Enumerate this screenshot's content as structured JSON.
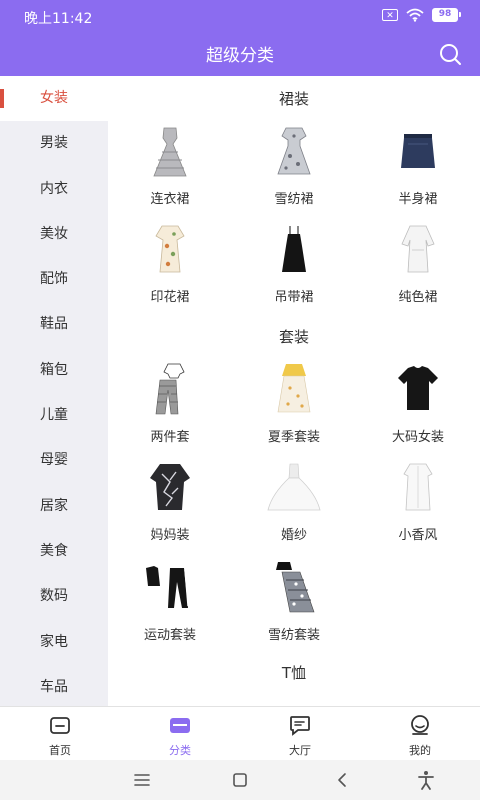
{
  "status": {
    "time": "晚上11:42",
    "battery": "98"
  },
  "header": {
    "title": "超级分类"
  },
  "sidebar": {
    "items": [
      {
        "label": "女装"
      },
      {
        "label": "男装"
      },
      {
        "label": "内衣"
      },
      {
        "label": "美妆"
      },
      {
        "label": "配饰"
      },
      {
        "label": "鞋品"
      },
      {
        "label": "箱包"
      },
      {
        "label": "儿童"
      },
      {
        "label": "母婴"
      },
      {
        "label": "居家"
      },
      {
        "label": "美食"
      },
      {
        "label": "数码"
      },
      {
        "label": "家电"
      },
      {
        "label": "车品"
      }
    ]
  },
  "sections": [
    {
      "title": "裙装",
      "items": [
        {
          "label": "连衣裙",
          "icon": "plaid-dress-image"
        },
        {
          "label": "雪纺裙",
          "icon": "floral-dress-image"
        },
        {
          "label": "半身裙",
          "icon": "denim-skirt-image"
        },
        {
          "label": "印花裙",
          "icon": "print-dress-image"
        },
        {
          "label": "吊带裙",
          "icon": "slip-dress-image"
        },
        {
          "label": "纯色裙",
          "icon": "white-dress-image"
        }
      ]
    },
    {
      "title": "套装",
      "items": [
        {
          "label": "两件套",
          "icon": "two-piece-image"
        },
        {
          "label": "夏季套装",
          "icon": "summer-set-image"
        },
        {
          "label": "大码女装",
          "icon": "black-tee-image"
        },
        {
          "label": "妈妈装",
          "icon": "mom-wear-image"
        },
        {
          "label": "婚纱",
          "icon": "wedding-dress-image"
        },
        {
          "label": "小香风",
          "icon": "white-blouse-image"
        },
        {
          "label": "运动套装",
          "icon": "sport-set-image"
        },
        {
          "label": "雪纺套装",
          "icon": "chiffon-set-image"
        }
      ]
    },
    {
      "title": "T恤",
      "items": []
    }
  ],
  "tabbar": {
    "items": [
      {
        "label": "首页"
      },
      {
        "label": "分类"
      },
      {
        "label": "大厅"
      },
      {
        "label": "我的"
      }
    ]
  },
  "colors": {
    "accent": "#8b6cf0",
    "active_side": "#d9503f",
    "sidebar_bg": "#efeff4"
  }
}
